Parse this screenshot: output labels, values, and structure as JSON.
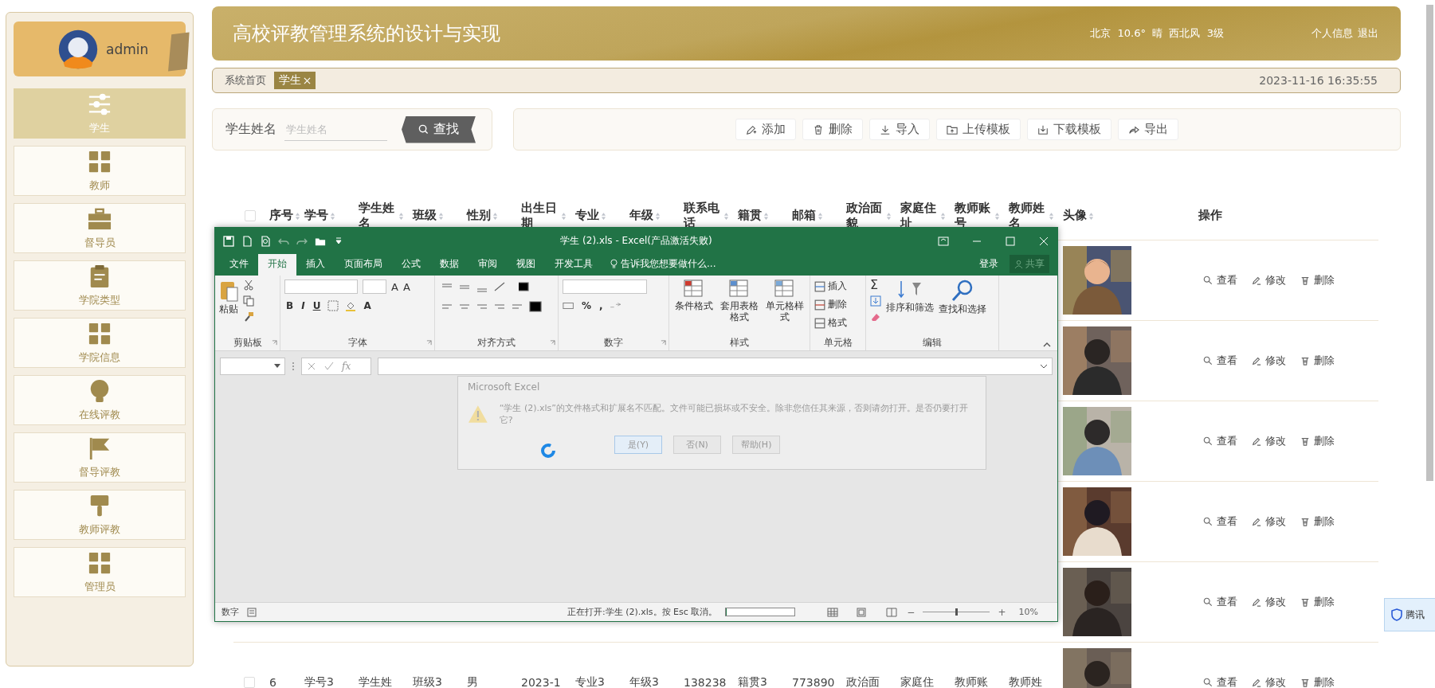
{
  "sidebar": {
    "user": "admin",
    "items": [
      {
        "label": "学生",
        "selected": true
      },
      {
        "label": "教师",
        "selected": false
      },
      {
        "label": "督导员",
        "selected": false
      },
      {
        "label": "学院类型",
        "selected": false
      },
      {
        "label": "学院信息",
        "selected": false
      },
      {
        "label": "在线评教",
        "selected": false
      },
      {
        "label": "督导评教",
        "selected": false
      },
      {
        "label": "教师评教",
        "selected": false
      },
      {
        "label": "管理员",
        "selected": false
      }
    ]
  },
  "header": {
    "title": "高校评教管理系统的设计与实现",
    "weather": "北京  10.6°  晴  西北风  3级",
    "links": [
      "个人信息",
      "退出"
    ]
  },
  "breadcrumb": {
    "items": [
      {
        "label": "系统首页",
        "selected": false,
        "closable": false
      },
      {
        "label": "学生",
        "selected": true,
        "closable": true
      }
    ],
    "datetime": "2023-11-16 16:35:55"
  },
  "search": {
    "label": "学生姓名",
    "placeholder": "学生姓名",
    "button": "查找"
  },
  "toolbar": [
    "添加",
    "删除",
    "导入",
    "上传模板",
    "下载模板",
    "导出"
  ],
  "table": {
    "checked": false,
    "columns": [
      "序号",
      "学号",
      "学生姓名",
      "班级",
      "性别",
      "出生日期",
      "专业",
      "年级",
      "联系电话",
      "籍贯",
      "邮箱",
      "政治面貌",
      "家庭住址",
      "教师账号",
      "教师姓名",
      "头像",
      "操作"
    ],
    "rows": [
      {
        "cells": [],
        "actions": [
          "查看",
          "修改",
          "删除"
        ]
      },
      {
        "cells": [],
        "actions": [
          "查看",
          "修改",
          "删除"
        ]
      },
      {
        "cells": [],
        "actions": [
          "查看",
          "修改",
          "删除"
        ]
      },
      {
        "cells": [],
        "actions": [
          "查看",
          "修改",
          "删除"
        ]
      },
      {
        "cells": [],
        "actions": [
          "查看",
          "修改",
          "删除"
        ]
      },
      {
        "checked": false,
        "cells": [
          "6",
          "学号3",
          "学生姓",
          "班级3",
          "男",
          "2023-1",
          "专业3",
          "年级3",
          "138238",
          "籍贯3",
          "773890",
          "政治面",
          "家庭住",
          "教师账",
          "教师姓"
        ],
        "actions": [
          "查看",
          "修改",
          "删除"
        ]
      }
    ]
  },
  "excel": {
    "title": "学生 (2).xls - Excel(产品激活失败)",
    "tabs": [
      {
        "label": "文件",
        "selected": false
      },
      {
        "label": "开始",
        "selected": true
      },
      {
        "label": "插入",
        "selected": false
      },
      {
        "label": "页面布局",
        "selected": false
      },
      {
        "label": "公式",
        "selected": false
      },
      {
        "label": "数据",
        "selected": false
      },
      {
        "label": "审阅",
        "selected": false
      },
      {
        "label": "视图",
        "selected": false
      },
      {
        "label": "开发工具",
        "selected": false
      }
    ],
    "tell_me": "告诉我您想要做什么...",
    "sign_in": "登录",
    "share": "共享",
    "ribbon_groups": [
      {
        "kind": "clipboard",
        "label": "剪贴板",
        "items": [
          "粘贴"
        ]
      },
      {
        "kind": "font",
        "label": "字体",
        "items": [
          "B",
          "I",
          "U",
          "A"
        ],
        "grow": [
          "A",
          "A"
        ]
      },
      {
        "kind": "alignment",
        "label": "对齐方式"
      },
      {
        "kind": "number",
        "label": "数字",
        "items": [
          "%",
          ","
        ]
      },
      {
        "kind": "styles",
        "label": "样式",
        "items": [
          "条件格式",
          "套用表格格式",
          "单元格样式"
        ]
      },
      {
        "kind": "cells",
        "label": "单元格",
        "items": [
          "插入",
          "删除",
          "格式"
        ]
      },
      {
        "kind": "editing",
        "label": "编辑",
        "items": [
          "Σ",
          "排序和筛选",
          "查找和选择"
        ]
      }
    ],
    "formula_fx": "fx",
    "dialog": {
      "title": "Microsoft Excel",
      "message": "“学生 (2).xls”的文件格式和扩展名不匹配。文件可能已损坏或不安全。除非您信任其来源，否则请勿打开。是否仍要打开它?",
      "buttons": [
        "是(Y)",
        "否(N)",
        "帮助(H)"
      ]
    },
    "status": {
      "mode": "数字",
      "message": "正在打开:学生 (2).xls。按 Esc 取消。",
      "progress": {
        "level": 0
      },
      "zoom": {
        "level": 0.5
      },
      "zoom_out": "−",
      "zoom_in": "+",
      "zoom_text": "10%"
    }
  },
  "notification": {
    "text": "腾讯"
  }
}
